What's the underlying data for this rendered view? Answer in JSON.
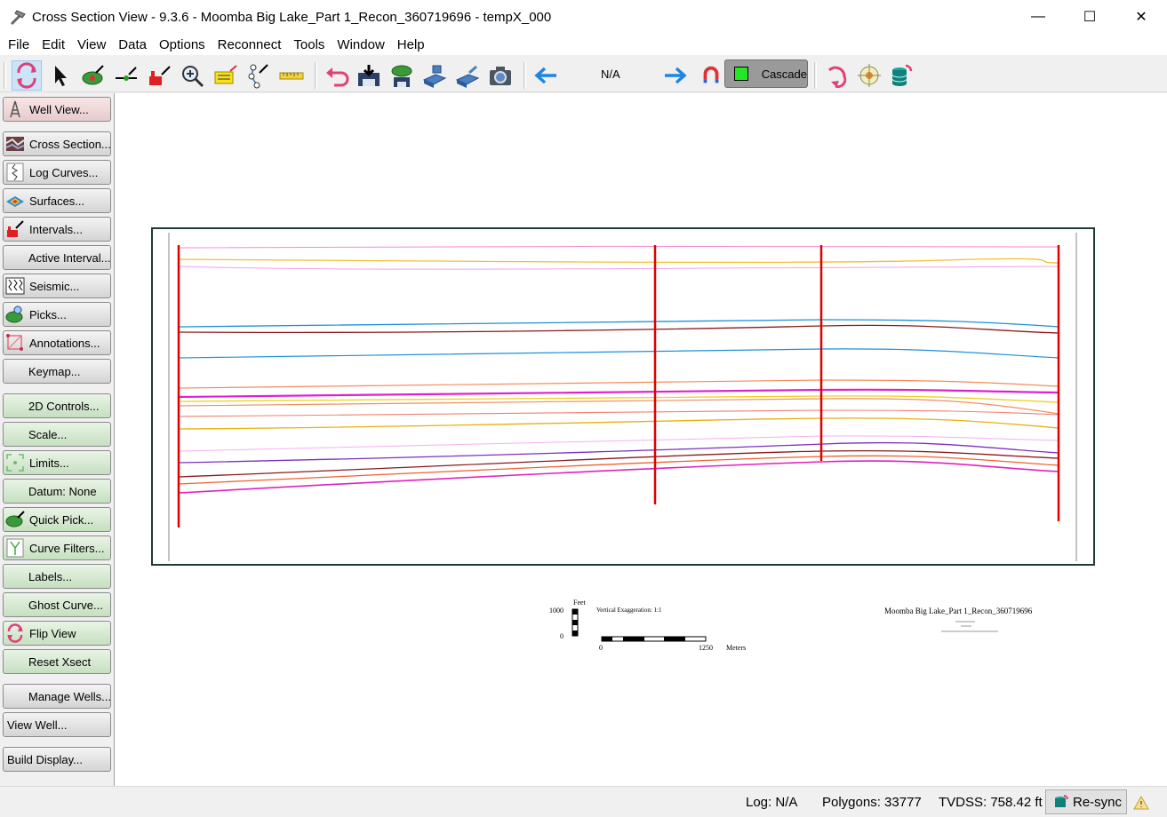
{
  "window": {
    "title": "Cross Section View - 9.3.6 - Moomba Big Lake_Part 1_Recon_360719696 - tempX_000",
    "minimize": "—",
    "maximize": "☐",
    "close": "✕"
  },
  "menu": [
    "File",
    "Edit",
    "View",
    "Data",
    "Options",
    "Reconnect",
    "Tools",
    "Window",
    "Help"
  ],
  "toolbar": {
    "nav_value": "N/A",
    "cascade_label": "Cascade",
    "cascade_color": "#25e625"
  },
  "sidebar": {
    "buttons": [
      {
        "label": "Well View...",
        "icon": "well-derrick-icon"
      },
      {
        "label": "Cross Section...",
        "icon": "cross-section-icon"
      },
      {
        "label": "Log Curves...",
        "icon": "log-curves-icon"
      },
      {
        "label": "Surfaces...",
        "icon": "surfaces-icon"
      },
      {
        "label": "Intervals...",
        "icon": "intervals-icon"
      },
      {
        "label": "Active Interval...",
        "icon": ""
      },
      {
        "label": "Seismic...",
        "icon": "seismic-icon"
      },
      {
        "label": "Picks...",
        "icon": "picks-icon"
      },
      {
        "label": "Annotations...",
        "icon": "annotations-icon"
      },
      {
        "label": "Keymap...",
        "icon": ""
      },
      {
        "label": "2D Controls...",
        "icon": ""
      },
      {
        "label": "Scale...",
        "icon": ""
      },
      {
        "label": "Limits...",
        "icon": "limits-icon"
      },
      {
        "label": "Datum: None",
        "icon": ""
      },
      {
        "label": "Quick Pick...",
        "icon": "quick-pick-icon"
      },
      {
        "label": "Curve Filters...",
        "icon": "curve-filters-icon"
      },
      {
        "label": "Labels...",
        "icon": ""
      },
      {
        "label": "Ghost Curve...",
        "icon": ""
      },
      {
        "label": "Flip View",
        "icon": "flip-view-icon"
      },
      {
        "label": "Reset Xsect",
        "icon": ""
      },
      {
        "label": "Manage Wells...",
        "icon": ""
      },
      {
        "label": "View Well...",
        "icon": ""
      },
      {
        "label": "Build Display...",
        "icon": ""
      }
    ]
  },
  "legend": {
    "scale_unit_top": "Feet",
    "scale_feet_max": "1000",
    "scale_feet_min": "0",
    "vertical_exaggeration": "Vertical Exaggeration: 1:1",
    "scale_meters_min": "0",
    "scale_meters_max": "1250",
    "scale_unit_bottom": "Meters",
    "project_title": "Moomba Big Lake_Part 1_Recon_360719696"
  },
  "status": {
    "log": "Log: N/A",
    "polygons": "Polygons: 33777",
    "tvdss": "TVDSS: 758.42 ft",
    "resync_label": "Re-sync"
  },
  "colors": {
    "well_line": "#e00000",
    "frame": "#1f3d2c"
  }
}
